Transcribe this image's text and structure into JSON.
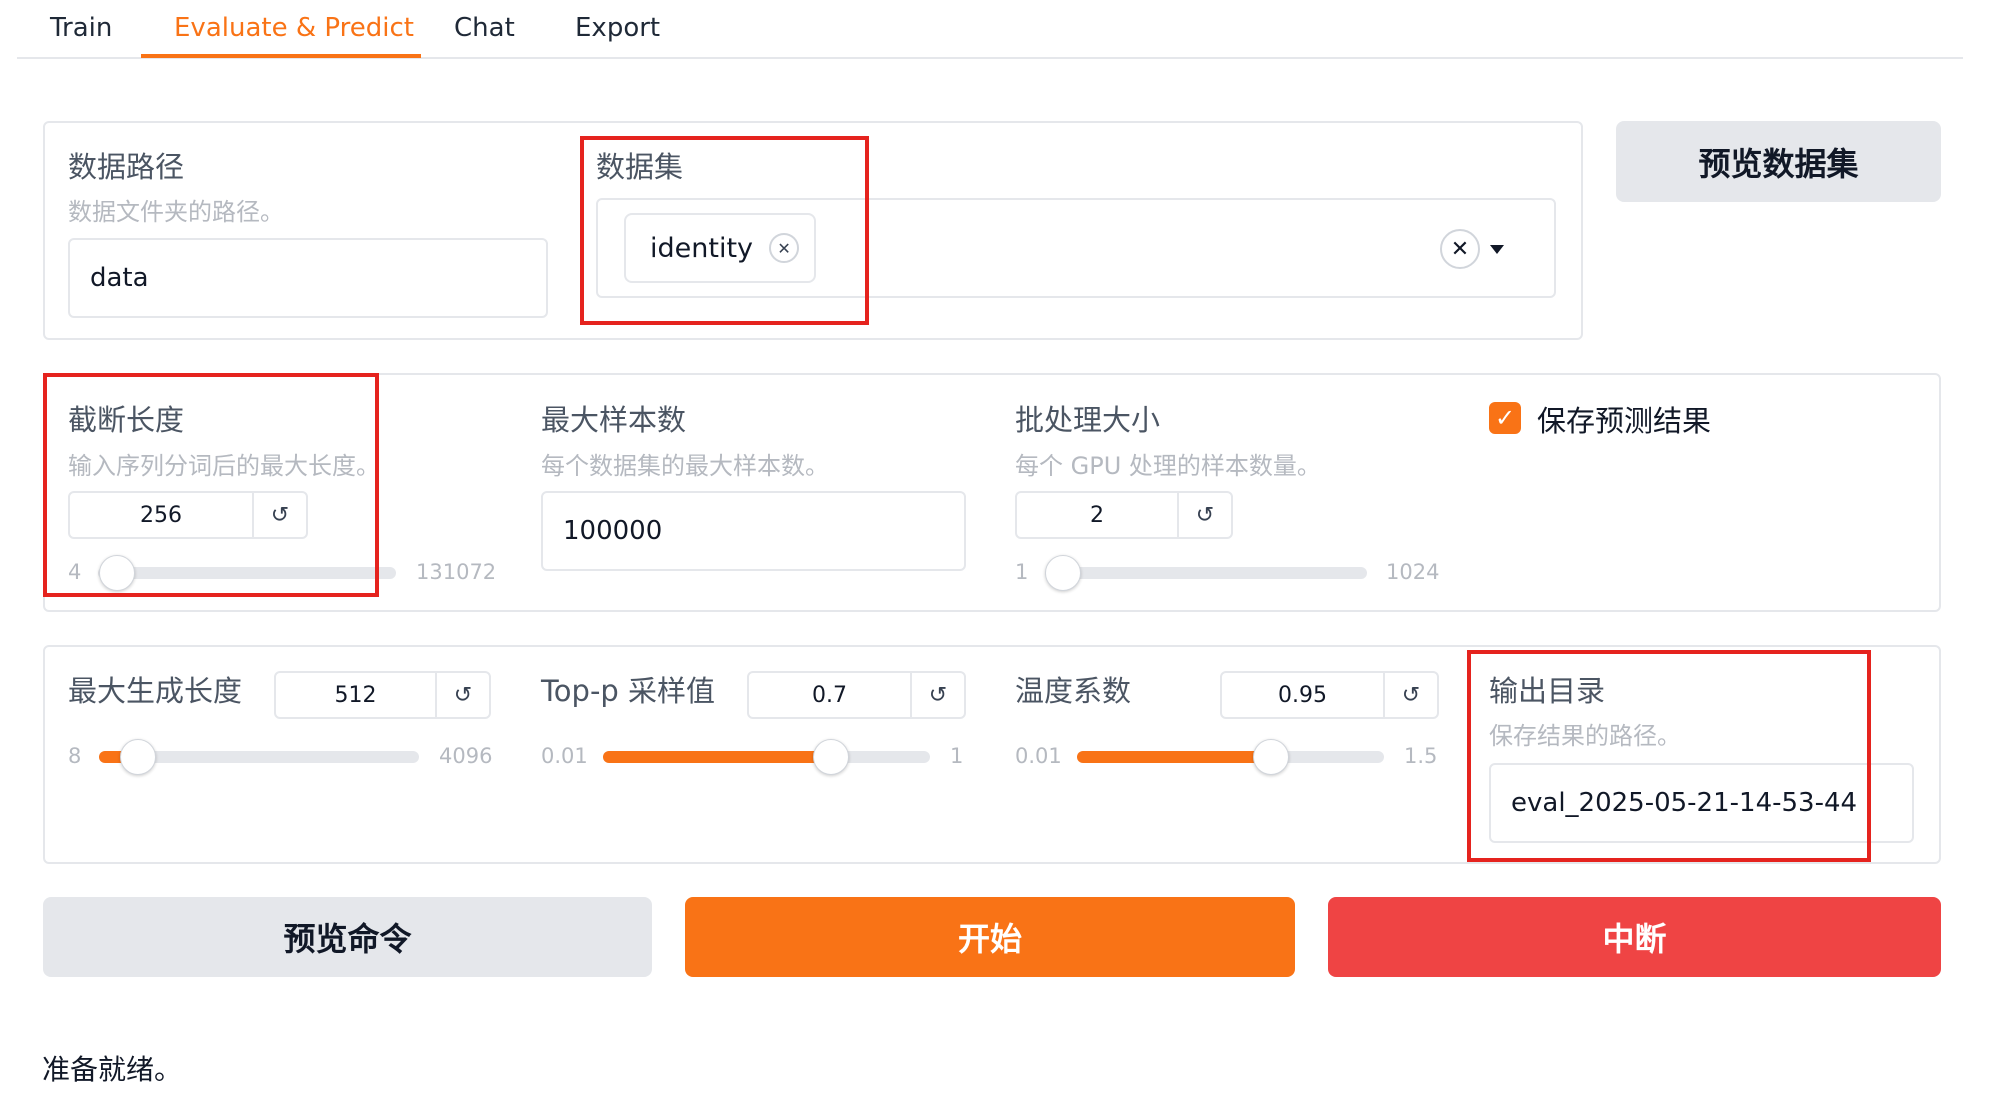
{
  "tabs": [
    {
      "label": "Train"
    },
    {
      "label": "Evaluate & Predict"
    },
    {
      "label": "Chat"
    },
    {
      "label": "Export"
    }
  ],
  "active_tab": "Evaluate & Predict",
  "accent_color": "#f97316",
  "danger_color": "#ef4444",
  "highlight_color": "#e5231e",
  "data_dir": {
    "label": "数据路径",
    "info": "数据文件夹的路径。",
    "value": "data"
  },
  "dataset": {
    "label": "数据集",
    "selected": [
      "identity"
    ]
  },
  "preview_dataset_button": "预览数据集",
  "cutoff_len": {
    "label": "截断长度",
    "info": "输入序列分词后的最大长度。",
    "value": "256",
    "min": "4",
    "max": "131072",
    "fraction": 0.002
  },
  "max_samples": {
    "label": "最大样本数",
    "info": "每个数据集的最大样本数。",
    "value": "100000"
  },
  "batch_size": {
    "label": "批处理大小",
    "info": "每个 GPU 处理的样本数量。",
    "value": "2",
    "min": "1",
    "max": "1024",
    "fraction": 0.001
  },
  "predict": {
    "label": "保存预测结果",
    "checked": true
  },
  "max_new_tokens": {
    "label": "最大生成长度",
    "value": "512",
    "min": "8",
    "max": "4096",
    "fraction": 0.123
  },
  "top_p": {
    "label": "Top-p 采样值",
    "value": "0.7",
    "min": "0.01",
    "max": "1",
    "fraction": 0.697
  },
  "temperature": {
    "label": "温度系数",
    "value": "0.95",
    "min": "0.01",
    "max": "1.5",
    "fraction": 0.631
  },
  "output_dir": {
    "label": "输出目录",
    "info": "保存结果的路径。",
    "value": "eval_2025-05-21-14-53-44"
  },
  "buttons": {
    "preview_cmd": "预览命令",
    "start": "开始",
    "stop": "中断"
  },
  "reset_icon": "↺",
  "status": "准备就绪。"
}
